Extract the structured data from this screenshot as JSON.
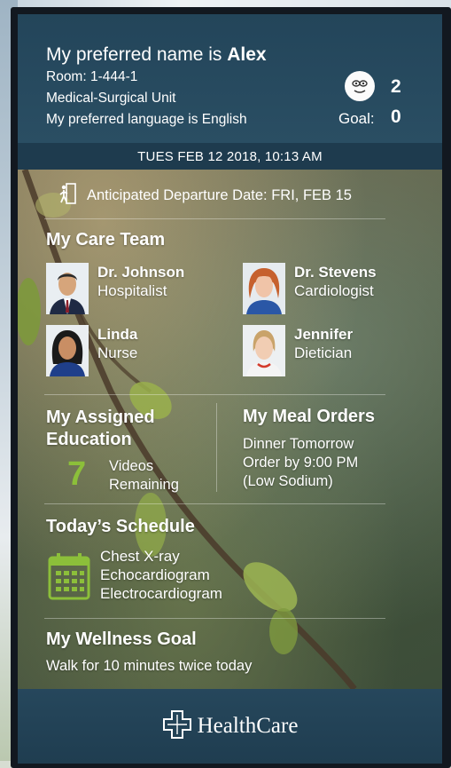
{
  "header": {
    "name_prefix": "My preferred name is",
    "name": "Alex",
    "room": "Room: 1-444-1",
    "unit": "Medical-Surgical Unit",
    "language": "My preferred language is English",
    "points": "2",
    "goal_label": "Goal:",
    "goal_value": "0"
  },
  "date_bar": "TUES FEB 12 2018, 10:13 AM",
  "departure": "Anticipated Departure Date:  FRI, FEB 15",
  "care_team": {
    "title": "My Care Team",
    "members": [
      {
        "name": "Dr. Johnson",
        "role": "Hospitalist"
      },
      {
        "name": "Dr. Stevens",
        "role": "Cardiologist"
      },
      {
        "name": "Linda",
        "role": "Nurse"
      },
      {
        "name": "Jennifer",
        "role": "Dietician"
      }
    ]
  },
  "education": {
    "title_line1": "My Assigned",
    "title_line2": "Education",
    "count": "7",
    "label_line1": "Videos",
    "label_line2": "Remaining"
  },
  "meals": {
    "title": "My Meal Orders",
    "line1": "Dinner Tomorrow",
    "line2": "Order by 9:00 PM",
    "line3": "(Low Sodium)"
  },
  "schedule": {
    "title": "Today’s Schedule",
    "items": [
      "Chest X-ray",
      "Echocardiogram",
      "Electrocardiogram"
    ]
  },
  "wellness": {
    "title": "My Wellness Goal",
    "text": "Walk for 10 minutes twice today"
  },
  "footer": {
    "brand": "HealthCare"
  },
  "colors": {
    "header_bg": "#23455a",
    "accent_green": "#8cbf3a",
    "footer_bg": "#22425a"
  }
}
